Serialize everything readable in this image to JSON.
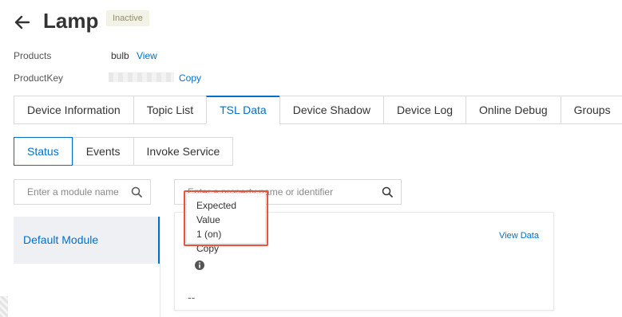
{
  "header": {
    "title": "Lamp",
    "status_badge": "Inactive"
  },
  "info": {
    "products_label": "Products",
    "products_value": "bulb",
    "products_link": "View",
    "productkey_label": "ProductKey",
    "productkey_link": "Copy"
  },
  "tabs": [
    {
      "label": "Device Information"
    },
    {
      "label": "Topic List"
    },
    {
      "label": "TSL Data"
    },
    {
      "label": "Device Shadow"
    },
    {
      "label": "Device Log"
    },
    {
      "label": "Online Debug"
    },
    {
      "label": "Groups"
    }
  ],
  "subtabs": [
    {
      "label": "Status"
    },
    {
      "label": "Events"
    },
    {
      "label": "Invoke Service"
    }
  ],
  "module_search": {
    "placeholder": "Enter a module name"
  },
  "property_search": {
    "placeholder": "Enter a property name or identifier"
  },
  "modules": [
    {
      "label": "Default Module"
    }
  ],
  "card": {
    "view_data": "View Data",
    "value": "--"
  },
  "tooltip": {
    "title": "Expected Value",
    "value": "1 (on)",
    "copy": "Copy"
  },
  "colors": {
    "accent": "#0070cc",
    "highlight": "#e5553b"
  }
}
